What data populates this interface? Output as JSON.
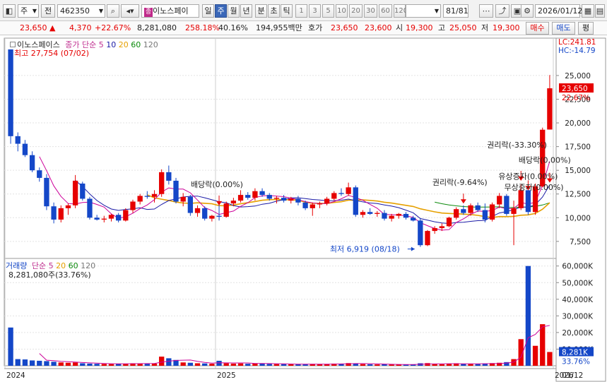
{
  "toolbar": {
    "type_select": "주",
    "prev_label": "전",
    "code": "462350",
    "stock_name": "이노스페이",
    "period_tabs": [
      "일",
      "주",
      "월",
      "년",
      "분",
      "초",
      "틱"
    ],
    "active_period": "주",
    "interval_buttons": [
      "1",
      "3",
      "5",
      "10",
      "20",
      "30",
      "60",
      "120"
    ],
    "count": "81",
    "count_total": "/81",
    "date": "2026/01/12"
  },
  "quote": {
    "price": "23,650",
    "change_arrow": "▲",
    "change": "4,370",
    "change_pct": "+22.67%",
    "volume": "8,281,080",
    "volume_ratio": "258.18%",
    "turnover_pct": "40.16%",
    "amount": "194,955백만",
    "hoga_label": "호가",
    "ask": "23,650",
    "bid": "23,600",
    "open_label": "시",
    "open": "19,300",
    "high_label": "고",
    "high": "25,050",
    "low_label": "저",
    "low": "19,300",
    "buy_label": "매수",
    "sell_label": "매도",
    "eval_label": "평"
  },
  "price_panel": {
    "legend_name": "이노스페이스",
    "legend_ma_label": "종가 단순",
    "legend_ma_periods": [
      "5",
      "10",
      "20",
      "60",
      "120"
    ],
    "high_annotation": "최고 27,754 (07/02)",
    "low_annotation": "최저 6,919 (08/18)",
    "lc": "LC:241.81",
    "hc": "HC:-14.79",
    "current_price_tag": "23,650",
    "current_pct_tag": "22.67%",
    "event_labels": [
      "배당락(0.00%)",
      "권리락(-9.64%)",
      "권리락(-33.30%)",
      "유상증자(0.00%)",
      "무상증자(0.00%)",
      "배당락(0.00%)"
    ]
  },
  "volume_panel": {
    "legend_name": "거래량",
    "legend_ma_label": "단순",
    "legend_ma_periods": [
      "5",
      "20",
      "60",
      "120"
    ],
    "current_volume": "8,281,080주(33.76%)",
    "current_tag": "8,281K",
    "current_pct_tag": "33.76%"
  },
  "axis": {
    "x_labels": [
      "2024",
      "2025",
      "2026"
    ],
    "last_date": "01/12",
    "price_ticks": [
      "25,000",
      "22,500",
      "20,000",
      "17,500",
      "15,000",
      "12,500",
      "10,000",
      "7,500"
    ],
    "volume_ticks": [
      "60,000K",
      "50,000K",
      "40,000K",
      "30,000K",
      "20,000K",
      "10,000K"
    ]
  },
  "colors": {
    "up": "#e60000",
    "down": "#1447c8",
    "ma5": "#cc0099",
    "ma10": "#1a1aa6",
    "ma20": "#e6a000",
    "ma60": "#0b8a0b",
    "ma120": "#777777"
  },
  "chart_data": {
    "type": "candlestick",
    "price_range": [
      6919,
      27754
    ],
    "volume_max_k": 60000,
    "candles": [
      {
        "o": 27754,
        "h": 27754,
        "l": 17800,
        "c": 18600,
        "v": 23000
      },
      {
        "o": 18600,
        "h": 19000,
        "l": 17000,
        "c": 17800,
        "v": 4000
      },
      {
        "o": 17800,
        "h": 18200,
        "l": 16400,
        "c": 16600,
        "v": 3800
      },
      {
        "o": 16600,
        "h": 17000,
        "l": 14800,
        "c": 15000,
        "v": 3200
      },
      {
        "o": 15000,
        "h": 15300,
        "l": 13800,
        "c": 14200,
        "v": 3000
      },
      {
        "o": 14200,
        "h": 14600,
        "l": 10800,
        "c": 11200,
        "v": 2800
      },
      {
        "o": 11200,
        "h": 11600,
        "l": 9400,
        "c": 9800,
        "v": 2400
      },
      {
        "o": 9800,
        "h": 11300,
        "l": 9500,
        "c": 11000,
        "v": 2000
      },
      {
        "o": 11000,
        "h": 11500,
        "l": 10300,
        "c": 11300,
        "v": 1800
      },
      {
        "o": 11300,
        "h": 14500,
        "l": 11000,
        "c": 13900,
        "v": 2000
      },
      {
        "o": 13600,
        "h": 13800,
        "l": 11800,
        "c": 12000,
        "v": 1500
      },
      {
        "o": 12000,
        "h": 12200,
        "l": 9800,
        "c": 10000,
        "v": 1300
      },
      {
        "o": 10000,
        "h": 10300,
        "l": 9700,
        "c": 9800,
        "v": 1200
      },
      {
        "o": 9800,
        "h": 10200,
        "l": 9500,
        "c": 9900,
        "v": 1100
      },
      {
        "o": 9900,
        "h": 10400,
        "l": 9600,
        "c": 10300,
        "v": 1000
      },
      {
        "o": 10300,
        "h": 10500,
        "l": 9500,
        "c": 9700,
        "v": 1200
      },
      {
        "o": 9700,
        "h": 11000,
        "l": 9600,
        "c": 10800,
        "v": 1300
      },
      {
        "o": 10800,
        "h": 11900,
        "l": 10500,
        "c": 11700,
        "v": 1500
      },
      {
        "o": 11700,
        "h": 12500,
        "l": 11400,
        "c": 12300,
        "v": 1400
      },
      {
        "o": 12300,
        "h": 12800,
        "l": 12000,
        "c": 12200,
        "v": 1200
      },
      {
        "o": 12200,
        "h": 12900,
        "l": 11600,
        "c": 12500,
        "v": 1300
      },
      {
        "o": 12500,
        "h": 15100,
        "l": 12200,
        "c": 14800,
        "v": 5500
      },
      {
        "o": 14800,
        "h": 15500,
        "l": 13500,
        "c": 13900,
        "v": 4500
      },
      {
        "o": 13900,
        "h": 14200,
        "l": 11500,
        "c": 11700,
        "v": 3500
      },
      {
        "o": 11700,
        "h": 12600,
        "l": 11200,
        "c": 12200,
        "v": 2000
      },
      {
        "o": 12200,
        "h": 12400,
        "l": 10200,
        "c": 10500,
        "v": 1800
      },
      {
        "o": 10500,
        "h": 11300,
        "l": 10100,
        "c": 11000,
        "v": 1500
      },
      {
        "o": 11000,
        "h": 11200,
        "l": 9700,
        "c": 9900,
        "v": 1400
      },
      {
        "o": 9900,
        "h": 10300,
        "l": 9600,
        "c": 10200,
        "v": 1200
      },
      {
        "o": 10200,
        "h": 11400,
        "l": 9700,
        "c": 10100,
        "v": 3000
      },
      {
        "o": 10100,
        "h": 11700,
        "l": 10000,
        "c": 11500,
        "v": 1500
      },
      {
        "o": 11500,
        "h": 12100,
        "l": 11200,
        "c": 11800,
        "v": 1300
      },
      {
        "o": 11800,
        "h": 12900,
        "l": 11600,
        "c": 12400,
        "v": 1400
      },
      {
        "o": 12400,
        "h": 12700,
        "l": 11900,
        "c": 12100,
        "v": 1200
      },
      {
        "o": 12100,
        "h": 13100,
        "l": 11800,
        "c": 12800,
        "v": 1500
      },
      {
        "o": 12800,
        "h": 13100,
        "l": 12200,
        "c": 12400,
        "v": 1300
      },
      {
        "o": 12400,
        "h": 12600,
        "l": 11800,
        "c": 12000,
        "v": 1100
      },
      {
        "o": 12000,
        "h": 12300,
        "l": 11500,
        "c": 12100,
        "v": 1000
      },
      {
        "o": 12100,
        "h": 12400,
        "l": 11600,
        "c": 11800,
        "v": 1000
      },
      {
        "o": 11800,
        "h": 12200,
        "l": 11500,
        "c": 12000,
        "v": 900
      },
      {
        "o": 12000,
        "h": 12300,
        "l": 11300,
        "c": 11600,
        "v": 900
      },
      {
        "o": 11600,
        "h": 11800,
        "l": 10800,
        "c": 11000,
        "v": 900
      },
      {
        "o": 11000,
        "h": 11600,
        "l": 10200,
        "c": 11400,
        "v": 1100
      },
      {
        "o": 11400,
        "h": 11700,
        "l": 11000,
        "c": 11500,
        "v": 900
      },
      {
        "o": 11500,
        "h": 12200,
        "l": 11300,
        "c": 12000,
        "v": 1000
      },
      {
        "o": 12000,
        "h": 12800,
        "l": 11800,
        "c": 12600,
        "v": 1300
      },
      {
        "o": 12600,
        "h": 13100,
        "l": 12300,
        "c": 12500,
        "v": 1200
      },
      {
        "o": 12500,
        "h": 13700,
        "l": 12300,
        "c": 13200,
        "v": 1600
      },
      {
        "o": 13200,
        "h": 13400,
        "l": 10100,
        "c": 10300,
        "v": 1500
      },
      {
        "o": 10300,
        "h": 10800,
        "l": 10000,
        "c": 10600,
        "v": 1000
      },
      {
        "o": 10600,
        "h": 11000,
        "l": 10300,
        "c": 10400,
        "v": 900
      },
      {
        "o": 10400,
        "h": 10700,
        "l": 10100,
        "c": 10500,
        "v": 800
      },
      {
        "o": 10500,
        "h": 10800,
        "l": 9700,
        "c": 9900,
        "v": 900
      },
      {
        "o": 9900,
        "h": 10400,
        "l": 9600,
        "c": 10200,
        "v": 800
      },
      {
        "o": 10200,
        "h": 10500,
        "l": 9900,
        "c": 10400,
        "v": 700
      },
      {
        "o": 10400,
        "h": 10600,
        "l": 9800,
        "c": 10000,
        "v": 700
      },
      {
        "o": 10000,
        "h": 10200,
        "l": 9600,
        "c": 9700,
        "v": 800
      },
      {
        "o": 9700,
        "h": 9900,
        "l": 6919,
        "c": 7100,
        "v": 1500
      },
      {
        "o": 7100,
        "h": 8700,
        "l": 7000,
        "c": 8600,
        "v": 1600
      },
      {
        "o": 8600,
        "h": 9100,
        "l": 8300,
        "c": 8900,
        "v": 1000
      },
      {
        "o": 8900,
        "h": 9400,
        "l": 8600,
        "c": 9100,
        "v": 900
      },
      {
        "o": 9100,
        "h": 10100,
        "l": 9000,
        "c": 10000,
        "v": 1200
      },
      {
        "o": 10000,
        "h": 11100,
        "l": 9800,
        "c": 10900,
        "v": 1500
      },
      {
        "o": 10900,
        "h": 11300,
        "l": 10300,
        "c": 10500,
        "v": 1100
      },
      {
        "o": 10500,
        "h": 11500,
        "l": 10200,
        "c": 11300,
        "v": 1200
      },
      {
        "o": 11300,
        "h": 11600,
        "l": 10600,
        "c": 10800,
        "v": 1000
      },
      {
        "o": 10800,
        "h": 11500,
        "l": 9500,
        "c": 9800,
        "v": 1400
      },
      {
        "o": 9800,
        "h": 11600,
        "l": 9600,
        "c": 11400,
        "v": 1600
      },
      {
        "o": 11400,
        "h": 12600,
        "l": 11000,
        "c": 12300,
        "v": 1800
      },
      {
        "o": 12300,
        "h": 12500,
        "l": 10200,
        "c": 10400,
        "v": 2200
      },
      {
        "o": 10400,
        "h": 11800,
        "l": 7100,
        "c": 11000,
        "v": 4000
      },
      {
        "o": 11000,
        "h": 13500,
        "l": 10800,
        "c": 12900,
        "v": 16000
      },
      {
        "o": 12900,
        "h": 13300,
        "l": 10300,
        "c": 10600,
        "v": 60000
      },
      {
        "o": 10600,
        "h": 13600,
        "l": 10300,
        "c": 13300,
        "v": 12000
      },
      {
        "o": 13300,
        "h": 19500,
        "l": 13200,
        "c": 19280,
        "v": 25000
      },
      {
        "o": 19300,
        "h": 25050,
        "l": 19300,
        "c": 23650,
        "v": 8281
      }
    ]
  }
}
